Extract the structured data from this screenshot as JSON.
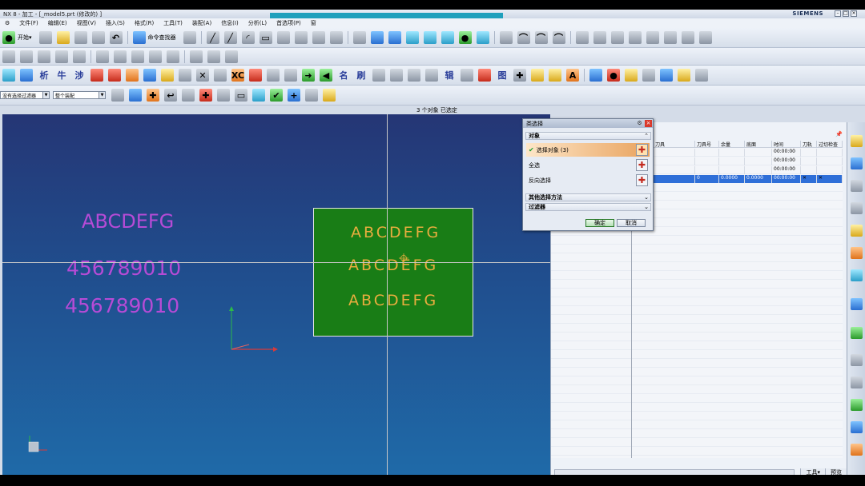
{
  "window": {
    "title": "NX 8 - 加工 - [_model5.prt  (修改的) ]",
    "brand": "SIEMENS"
  },
  "menu": [
    "文件(F)",
    "编辑(E)",
    "视图(V)",
    "插入(S)",
    "格式(R)",
    "工具(T)",
    "装配(A)",
    "信息(I)",
    "分析(L)",
    "首选项(P)",
    "窗"
  ],
  "toolbar": {
    "start_label": "开始▾",
    "command_finder": "命令查找器",
    "glyphs": [
      "析",
      "牛",
      "涉",
      "名",
      "刷",
      "辑",
      "图"
    ],
    "filter_select": "没有选择过滤器",
    "assembly_select": "整个装配"
  },
  "status": {
    "selection_count": "3 个对象  已选定"
  },
  "viewport": {
    "magenta_texts": [
      "ABCDEFG",
      "456789010",
      "456789010"
    ],
    "green_texts": [
      "ABCDEFG",
      "ABCDEFG",
      "ABCDEFG"
    ],
    "colors": {
      "background_top": "#253675",
      "background_bottom": "#1f6aa8",
      "text_magenta": "#b64bd6",
      "box_green": "#197d16",
      "text_orange": "#e8ad3e"
    }
  },
  "dialog": {
    "title": "类选择",
    "group_object": "对象",
    "options": [
      {
        "label": "选择对象 (3)",
        "checked": true
      },
      {
        "label": "全选",
        "checked": false
      },
      {
        "label": "反向选择",
        "checked": false
      }
    ],
    "group_other": "其他选择方法",
    "group_filter": "过滤器",
    "ok": "确定",
    "cancel": "取消"
  },
  "navigator": {
    "columns": [
      "刀具",
      "刀具号",
      "余量",
      "底面",
      "时间",
      "刀轨",
      "过切检查"
    ],
    "rows": [
      {
        "tool": "",
        "num": "",
        "stock": "",
        "floor": "",
        "time": "00:00:00",
        "path": "",
        "gouge": ""
      },
      {
        "tool": "",
        "num": "",
        "stock": "",
        "floor": "",
        "time": "00:00:00",
        "path": "",
        "gouge": ""
      },
      {
        "tool": "",
        "num": "",
        "stock": "",
        "floor": "",
        "time": "00:00:00",
        "path": "",
        "gouge": ""
      },
      {
        "tool": "",
        "num": "0",
        "stock": "0.0000",
        "floor": "0.0000",
        "time": "00:00:00",
        "path": "✕",
        "gouge": "✕",
        "selected": true
      }
    ],
    "bottom_buttons": [
      "工具▾",
      "预览"
    ]
  }
}
